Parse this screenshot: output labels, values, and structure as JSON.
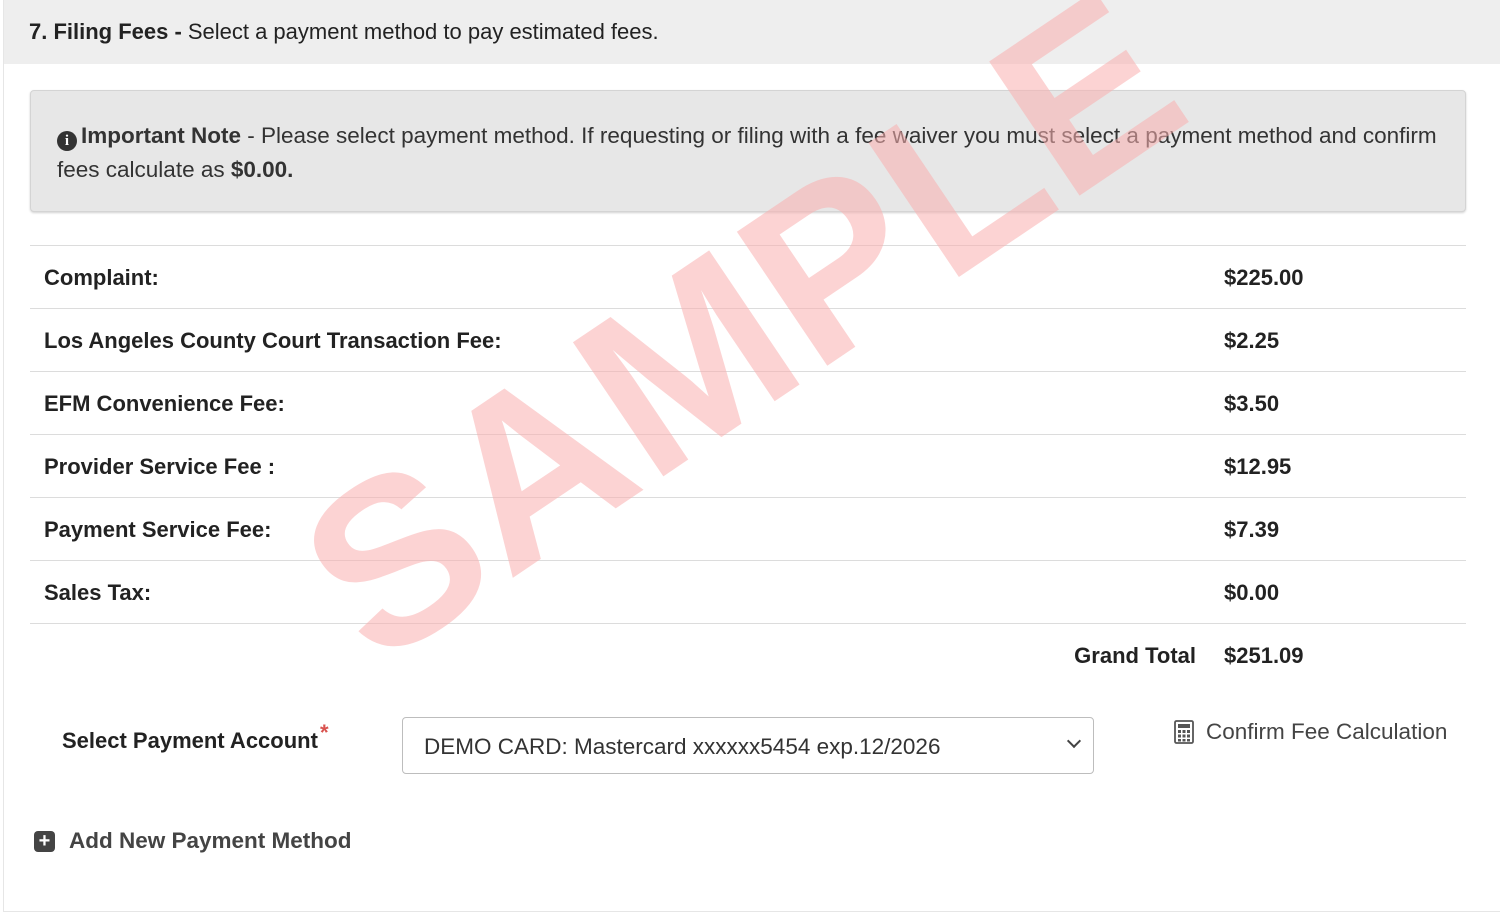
{
  "header": {
    "section_title": "7. Filing Fees -",
    "subtitle": "Select a payment method to pay estimated fees."
  },
  "note": {
    "icon": "info-circle-icon",
    "title": "Important Note",
    "separator": " - ",
    "text": "Please select payment method. If requesting or filing with a fee waiver you must select a payment method and confirm fees calculate as ",
    "amount": "$0.00."
  },
  "fees": [
    {
      "label": "Complaint:",
      "value": "$225.00"
    },
    {
      "label": "Los Angeles County Court Transaction Fee:",
      "value": "$2.25"
    },
    {
      "label": "EFM Convenience Fee:",
      "value": "$3.50"
    },
    {
      "label": "Provider Service Fee :",
      "value": "$12.95"
    },
    {
      "label": "Payment Service Fee:",
      "value": "$7.39"
    },
    {
      "label": "Sales Tax:",
      "value": "$0.00"
    }
  ],
  "total": {
    "label": "Grand Total",
    "value": "$251.09"
  },
  "payment": {
    "label": "Select Payment Account",
    "required_mark": "*",
    "selected": "DEMO CARD: Mastercard xxxxxx5454 exp.12/2026"
  },
  "confirm_label": "Confirm Fee Calculation",
  "add_method_label": "Add New Payment Method",
  "watermark": "SAMPLE",
  "colors": {
    "required": "#d9534f",
    "watermark": "#faafaf",
    "header_bg": "#eeeeee",
    "note_bg": "#e7e7e7"
  }
}
